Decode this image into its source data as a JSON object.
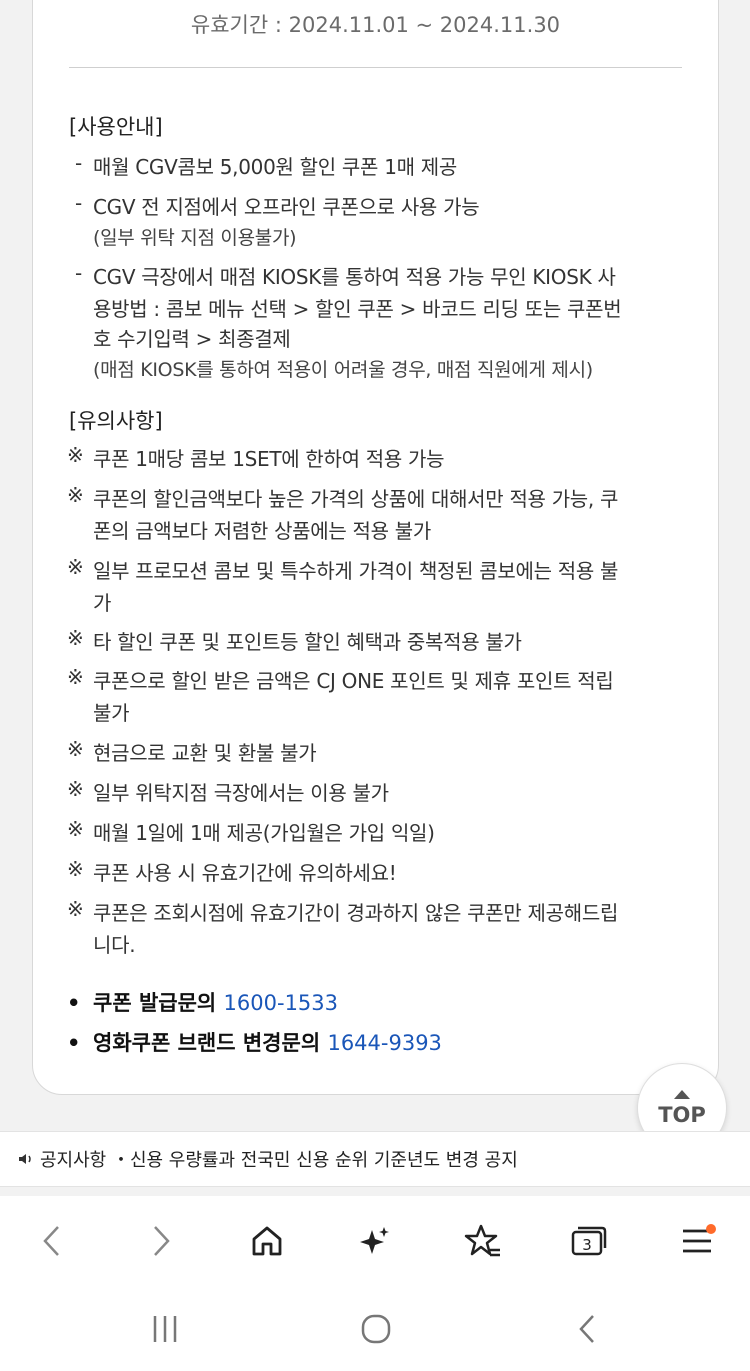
{
  "coupon": {
    "validity": "유효기간 : 2024.11.01 ~ 2024.11.30",
    "usage_title": "[사용안내]",
    "usage": [
      {
        "mark": "-",
        "text": "매월 CGV콤보 5,000원 할인 쿠폰 1매 제공"
      },
      {
        "mark": "-",
        "text": "CGV 전 지점에서 오프라인 쿠폰으로 사용 가능"
      },
      {
        "mark": "",
        "text": "(일부 위탁 지점 이용불가)"
      },
      {
        "mark": "-",
        "text": "CGV 극장에서 매점 KIOSK를 통하여 적용 가능 무인 KIOSK 사"
      },
      {
        "mark": "",
        "text": "용방법 : 콤보 메뉴 선택 > 할인 쿠폰 > 바코드 리딩 또는 쿠폰번"
      },
      {
        "mark": "",
        "text": "호 수기입력 > 최종결제"
      },
      {
        "mark": "",
        "text": "(매점 KIOSK를 통하여 적용이 어려울 경우, 매점 직원에게 제시)"
      }
    ],
    "caution_title": "[유의사항]",
    "caution": [
      {
        "mark": "※",
        "text": "쿠폰 1매당 콤보 1SET에 한하여 적용 가능"
      },
      {
        "mark": "※",
        "text": "쿠폰의 할인금액보다 높은 가격의 상품에 대해서만 적용 가능, 쿠"
      },
      {
        "mark": "",
        "text": "폰의 금액보다 저렴한 상품에는 적용 불가"
      },
      {
        "mark": "※",
        "text": "일부 프로모션 콤보 및 특수하게 가격이 책정된 콤보에는 적용 불"
      },
      {
        "mark": "",
        "text": "가"
      },
      {
        "mark": "※",
        "text": "타 할인 쿠폰 및 포인트등 할인 혜택과 중복적용 불가"
      },
      {
        "mark": "※",
        "text": "쿠폰으로 할인 받은 금액은 CJ ONE 포인트 및 제휴 포인트 적립"
      },
      {
        "mark": "",
        "text": "불가"
      },
      {
        "mark": "※",
        "text": "현금으로 교환 및 환불 불가"
      },
      {
        "mark": "※",
        "text": "일부 위탁지점 극장에서는 이용 불가"
      },
      {
        "mark": "※",
        "text": "매월 1일에 1매 제공(가입월은 가입 익일)"
      },
      {
        "mark": "※",
        "text": "쿠폰 사용 시 유효기간에 유의하세요!"
      },
      {
        "mark": "※",
        "text": "쿠폰은 조회시점에 유효기간이 경과하지 않은 쿠폰만 제공해드립"
      },
      {
        "mark": "",
        "text": "니다."
      }
    ],
    "contacts": [
      {
        "bullet": "•",
        "label": "쿠폰 발급문의 ",
        "number": "1600-1533"
      },
      {
        "bullet": "•",
        "label": "영화쿠폰 브랜드 변경문의 ",
        "number": "1644-9393"
      }
    ]
  },
  "top_button": {
    "label": "TOP"
  },
  "notice": {
    "text": "공지사항 ・신용 우량률과 전국민 신용 순위 기준년도 변경 공지"
  },
  "browser_toolbar": {
    "tab_count": "3",
    "icons": [
      "back-icon",
      "forward-icon",
      "home-icon",
      "ai-sparkle-icon",
      "bookmark-star-icon",
      "tabs-icon",
      "menu-icon"
    ]
  },
  "colors": {
    "link_blue": "#1a56b8",
    "badge_orange": "#ff6a2a"
  }
}
